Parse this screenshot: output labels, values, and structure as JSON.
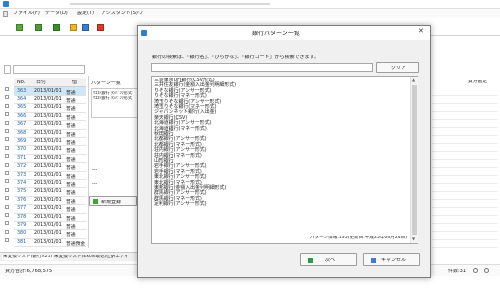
{
  "app": {
    "menu": [
      "ファイル(F)",
      "データ(D)",
      "設定(T)",
      "アシスタント(S)",
      "ウ"
    ],
    "grid_headers": [
      "No.",
      "日付",
      "借"
    ],
    "grid_rows": [
      {
        "no": "363",
        "date": "2013/01/01",
        "type": "普通"
      },
      {
        "no": "364",
        "date": "2013/01/01",
        "type": "普通"
      },
      {
        "no": "365",
        "date": "2013/01/01",
        "type": "普通"
      },
      {
        "no": "366",
        "date": "2013/01/01",
        "type": "普通"
      },
      {
        "no": "367",
        "date": "2013/01/01",
        "type": "普通"
      },
      {
        "no": "368",
        "date": "2013/01/01",
        "type": "普通"
      },
      {
        "no": "369",
        "date": "2013/01/01",
        "type": "普通"
      },
      {
        "no": "370",
        "date": "2013/01/01",
        "type": "普通"
      },
      {
        "no": "371",
        "date": "2013/01/01",
        "type": "普通"
      },
      {
        "no": "372",
        "date": "2013/01/01",
        "type": "普通"
      },
      {
        "no": "373",
        "date": "2013/01/01",
        "type": "普通"
      },
      {
        "no": "374",
        "date": "2013/01/01",
        "type": "普通"
      },
      {
        "no": "375",
        "date": "2013/01/01",
        "type": "普通"
      },
      {
        "no": "376",
        "date": "2013/01/01",
        "type": "普通"
      },
      {
        "no": "377",
        "date": "2013/01/01",
        "type": "普通"
      },
      {
        "no": "378",
        "date": "2013/01/01",
        "type": "普通"
      },
      {
        "no": "379",
        "date": "2013/01/01",
        "type": "普通"
      },
      {
        "no": "380",
        "date": "2013/01/01",
        "type": "普通"
      },
      {
        "no": "381",
        "date": "2013/01/01",
        "type": "普通預金"
      }
    ],
    "pattern_panel_title": "パターン一覧",
    "pattern_items": [
      "ｳｴｽﾄ銀行 ﾃﾝﾊﾟﾝﾂ形式",
      "ｳｴｽﾄ銀行 ﾃﾝﾊﾟﾝﾂ形式"
    ],
    "new_register": "新規登録",
    "dashes": [
      "---",
      "---"
    ],
    "right_header": "貸方勘定",
    "bottom_tabs": [
      "未変換リスト(銀行X21)",
      "未変換リスト(Excel取込)",
      "仕訳エディ"
    ],
    "status_left": "貸方合計:6,768,575",
    "status_right": "件数:31"
  },
  "dialog": {
    "title": "銀行パターン一覧",
    "instruction": "銀行の検索は、「銀行名」、「ひらがな」、「銀行コード」から検索できます。",
    "search_value": "",
    "clear_button": "クリア",
    "banks": [
      "三菱東京UFJ銀行(CSV形式)",
      "三井住友銀行(金額入出金列明細形式)",
      "りそな銀行(アンサー形式)",
      "りそな銀行(マネー形式)",
      "埼玉りそな銀行(アンサー形式)",
      "埼玉りそな銀行(マネー形式)",
      "ジャパンネット銀行(入出金)",
      "楽天銀行(CSV)",
      "北海道銀行(アンサー形式)",
      "北海道銀行(マネー形式)",
      "秋田銀行",
      "北都銀行(アンサー形式)",
      "北都銀行(マネー形式)",
      "荘内銀行(アンサー形式)",
      "荘内銀行(マネー形式)",
      "山形銀行",
      "岩手銀行(アンサー形式)",
      "岩手銀行(マネー形式)",
      "東北銀行(アンサー形式)",
      "東北銀行(マネー形式)",
      "東邦銀行(金額入出金列明細形式)",
      "群馬銀行(アンサー形式)",
      "群馬銀行(マネー形式)",
      "足利銀行(アンサー形式)"
    ],
    "pattern_info": "パターン情報:135(更新日:平成25年06月24日)",
    "next_button": "次へ",
    "cancel_button": "キャンセル"
  }
}
